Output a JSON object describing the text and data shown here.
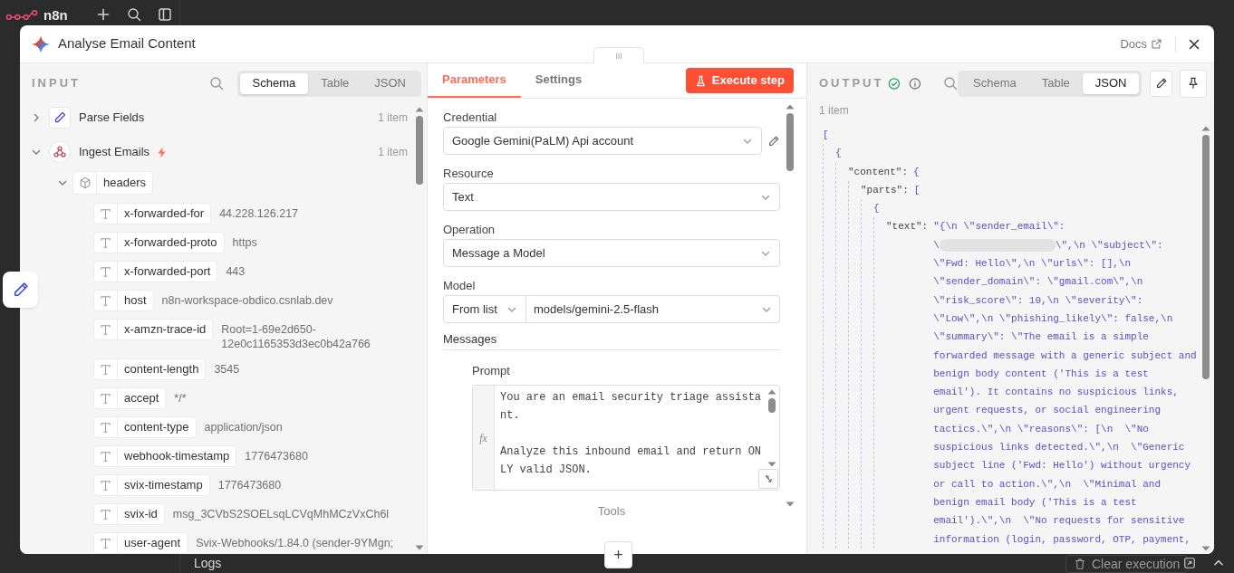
{
  "app": {
    "logo_text": "n8n",
    "bottom_tab": "Logs",
    "clear_button": "Clear execution"
  },
  "modal": {
    "title": "Analyse Email Content",
    "docs_link": "Docs"
  },
  "input": {
    "title": "INPUT",
    "view_tabs": [
      {
        "label": "Schema",
        "selected": true
      },
      {
        "label": "Table",
        "selected": false
      },
      {
        "label": "JSON",
        "selected": false
      }
    ],
    "tree": [
      {
        "kind": "edit-node",
        "label": "Parse Fields",
        "count": "1 item",
        "expanded": false,
        "trigger": false
      },
      {
        "kind": "webhook-node",
        "label": "Ingest Emails",
        "count": "1 item",
        "expanded": true,
        "trigger": true,
        "children": [
          {
            "kind": "object",
            "label": "headers",
            "expanded": true,
            "children": [
              {
                "kind": "string",
                "name": "x-forwarded-for",
                "value": "44.228.126.217"
              },
              {
                "kind": "string",
                "name": "x-forwarded-proto",
                "value": "https"
              },
              {
                "kind": "string",
                "name": "x-forwarded-port",
                "value": "443"
              },
              {
                "kind": "string",
                "name": "host",
                "value": "n8n-workspace-obdico.csnlab.dev"
              },
              {
                "kind": "string",
                "name": "x-amzn-trace-id",
                "value": "Root=1-69e2d650-12e0c1165353d3ec0b42a766"
              },
              {
                "kind": "string",
                "name": "content-length",
                "value": "3545"
              },
              {
                "kind": "string",
                "name": "accept",
                "value": "*/*"
              },
              {
                "kind": "string",
                "name": "content-type",
                "value": "application/json"
              },
              {
                "kind": "string",
                "name": "webhook-timestamp",
                "value": "1776473680"
              },
              {
                "kind": "string",
                "name": "svix-timestamp",
                "value": "1776473680"
              },
              {
                "kind": "string",
                "name": "svix-id",
                "value": "msg_3CVbS2SOELsqLCVqMhMCzVxCh6l"
              },
              {
                "kind": "string",
                "name": "user-agent",
                "value": "Svix-Webhooks/1.84.0 (sender-9YMgn;"
              }
            ]
          }
        ]
      }
    ]
  },
  "parameters": {
    "tabs": [
      {
        "label": "Parameters",
        "selected": true
      },
      {
        "label": "Settings",
        "selected": false
      }
    ],
    "execute_button": "Execute step",
    "fields": [
      {
        "kind": "select",
        "label": "Credential",
        "value": "Google Gemini(PaLM) Api account",
        "editable": true
      },
      {
        "kind": "select",
        "label": "Resource",
        "value": "Text",
        "editable": false
      },
      {
        "kind": "select",
        "label": "Operation",
        "value": "Message a Model",
        "editable": false
      },
      {
        "kind": "model",
        "label": "Model",
        "mode": "From list",
        "value": "models/gemini-2.5-flash"
      }
    ],
    "messages_title": "Messages",
    "prompt_label": "Prompt",
    "prompt_marker": "fx",
    "prompt": "You are an email security triage assistant.\n\nAnalyze this inbound email and return ONLY valid JSON.",
    "tools_label": "Tools",
    "add_button": "+"
  },
  "output": {
    "title": "OUTPUT",
    "success": true,
    "view_tabs": [
      {
        "label": "Schema",
        "selected": false
      },
      {
        "label": "Table",
        "selected": false
      },
      {
        "label": "JSON",
        "selected": true
      }
    ],
    "item_count": "1 item",
    "json": {
      "open": "[",
      "children": [
        {
          "open": "{",
          "children": [
            {
              "key": "\"content\":",
              "open": "{",
              "children": [
                {
                  "key": "\"parts\":",
                  "open": "[",
                  "children": [
                    {
                      "open": "{",
                      "children": [
                        {
                          "key": "\"text\":",
                          "value_lines": [
                            {
                              "text": "\"{\\n \\\"sender_email\\\":",
                              "redacted": false
                            },
                            {
                              "text": "\\",
                              "redacted": true,
                              "after": "\\\",\\n \\\"subject\\\":"
                            },
                            {
                              "text": "\\\"Fwd: Hello\\\",\\n \\\"urls\\\": [],\\n",
                              "redacted": false
                            },
                            {
                              "text": "\\\"sender_domain\\\": \\\"gmail.com\\\",\\n",
                              "redacted": false
                            },
                            {
                              "text": "\\\"risk_score\\\": 10,\\n \\\"severity\\\":",
                              "redacted": false
                            },
                            {
                              "text": "\\\"Low\\\",\\n \\\"phishing_likely\\\": false,\\n",
                              "redacted": false
                            },
                            {
                              "text": "\\\"summary\\\": \\\"The email is a simple",
                              "redacted": false
                            },
                            {
                              "text": "forwarded message with a generic subject and",
                              "redacted": false
                            },
                            {
                              "text": "benign body content ('This is a test",
                              "redacted": false
                            },
                            {
                              "text": "email'). It contains no suspicious links,",
                              "redacted": false
                            },
                            {
                              "text": "urgent requests, or social engineering",
                              "redacted": false
                            },
                            {
                              "text": "tactics.\\\",\\n \\\"reasons\\\": [\\n  \\\"No",
                              "redacted": false
                            },
                            {
                              "text": "suspicious links detected.\\\",\\n  \\\"Generic",
                              "redacted": false
                            },
                            {
                              "text": "subject line ('Fwd: Hello') without urgency",
                              "redacted": false
                            },
                            {
                              "text": "or call to action.\\\",\\n  \\\"Minimal and",
                              "redacted": false
                            },
                            {
                              "text": "benign email body ('This is a test",
                              "redacted": false
                            },
                            {
                              "text": "email').\\\",\\n  \\\"No requests for sensitive",
                              "redacted": false
                            },
                            {
                              "text": "information (login, password, OTP, payment,",
                              "redacted": false
                            }
                          ]
                        }
                      ]
                    }
                  ]
                }
              ]
            }
          ]
        }
      ]
    }
  }
}
